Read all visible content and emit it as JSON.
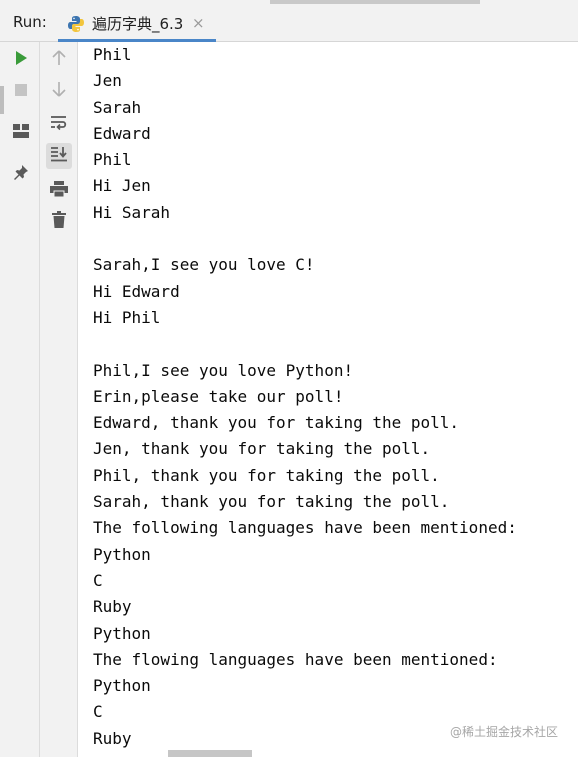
{
  "header": {
    "run_label": "Run:",
    "tab_title": "遍历字典_6.3",
    "tab_close": "×",
    "tab_icon": "python-icon"
  },
  "toolbar_outer": [
    {
      "name": "run-icon",
      "color": "#3a9b3a"
    },
    {
      "name": "stop-icon",
      "color": "#c0c0c0"
    },
    {
      "name": "layout-icon",
      "color": "#5a5a5a"
    },
    {
      "name": "pin-icon",
      "color": "#5a5a5a"
    }
  ],
  "toolbar_inner": [
    {
      "name": "up-arrow-icon",
      "color": "#b0b0b0"
    },
    {
      "name": "down-arrow-icon",
      "color": "#b0b0b0"
    },
    {
      "name": "soft-wrap-icon",
      "color": "#5a5a5a"
    },
    {
      "name": "scroll-to-end-icon",
      "color": "#5a5a5a",
      "active": true
    },
    {
      "name": "print-icon",
      "color": "#5a5a5a"
    },
    {
      "name": "trash-icon",
      "color": "#5a5a5a"
    }
  ],
  "console": {
    "lines": [
      "Phil",
      "Jen",
      "Sarah",
      "Edward",
      "Phil",
      "Hi Jen",
      "Hi Sarah",
      "",
      "Sarah,I see you love C!",
      "Hi Edward",
      "Hi Phil",
      "",
      "Phil,I see you love Python!",
      "Erin,please take our poll!",
      "Edward, thank you for taking the poll.",
      "Jen, thank you for taking the poll.",
      "Phil, thank you for taking the poll.",
      "Sarah, thank you for taking the poll.",
      "The following languages have been mentioned:",
      "Python",
      "C",
      "Ruby",
      "Python",
      "The flowing languages have been mentioned:",
      "Python",
      "C",
      "Ruby"
    ]
  },
  "watermark": "@稀土掘金技术社区"
}
